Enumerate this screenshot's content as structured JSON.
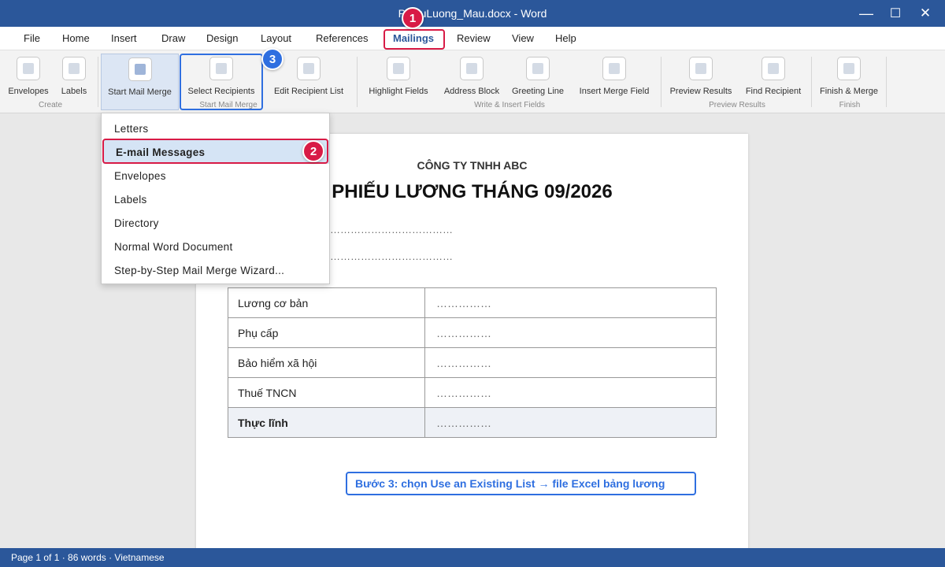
{
  "window": {
    "title": "PhieuLuong_Mau.docx - Word",
    "minimize_glyph": "—",
    "maximize_glyph": "☐",
    "close_glyph": "✕"
  },
  "tabs": [
    "File",
    "Home",
    "Insert",
    "Draw",
    "Design",
    "Layout",
    "References",
    "Mailings",
    "Review",
    "View",
    "Help"
  ],
  "active_tab": "Mailings",
  "ribbon": {
    "buttons": {
      "envelopes": "Envelopes",
      "labels": "Labels",
      "start_mail_merge": "Start Mail Merge",
      "select_recipients": "Select Recipients",
      "edit_recipient_list": "Edit Recipient List",
      "highlight_fields": "Highlight Fields",
      "address_block": "Address Block",
      "greeting_line": "Greeting Line",
      "insert_merge_field": "Insert Merge Field",
      "preview_results": "Preview Results",
      "find_recipient": "Find Recipient",
      "finish_merge": "Finish & Merge"
    },
    "groups": {
      "create": "Create",
      "start_mail_merge": "Start Mail Merge",
      "write_insert": "Write & Insert Fields",
      "preview": "Preview Results",
      "finish": "Finish"
    }
  },
  "dropdown": {
    "items": [
      "Letters",
      "E-mail Messages",
      "Envelopes",
      "Labels",
      "Directory",
      "Normal Word Document",
      "Step-by-Step Mail Merge Wizard..."
    ],
    "selected": "E-mail Messages"
  },
  "callouts": {
    "step1": "1",
    "step2": "2",
    "step3": "3"
  },
  "document": {
    "company": "CÔNG TY TNHH ABC",
    "title": "PHIẾU LƯƠNG THÁNG 09/2026",
    "field_line_1": "………………………………",
    "field_line_2": "………………………………",
    "rows": [
      {
        "label": "Lương cơ bản",
        "value": "……………"
      },
      {
        "label": "Phụ cấp",
        "value": "……………"
      },
      {
        "label": "Bảo hiểm xã hội",
        "value": "……………"
      },
      {
        "label": "Thuế TNCN",
        "value": "……………"
      },
      {
        "label": "Thực lĩnh",
        "value": "……………"
      }
    ],
    "note": "Bước 3: chọn Use an Existing List → file Excel bảng lương"
  },
  "status": "Page 1 of 1 · 86 words · Vietnamese",
  "colors": {
    "word_blue": "#2b579a",
    "highlight_red": "#d81b46",
    "highlight_blue": "#2f6fe0"
  }
}
